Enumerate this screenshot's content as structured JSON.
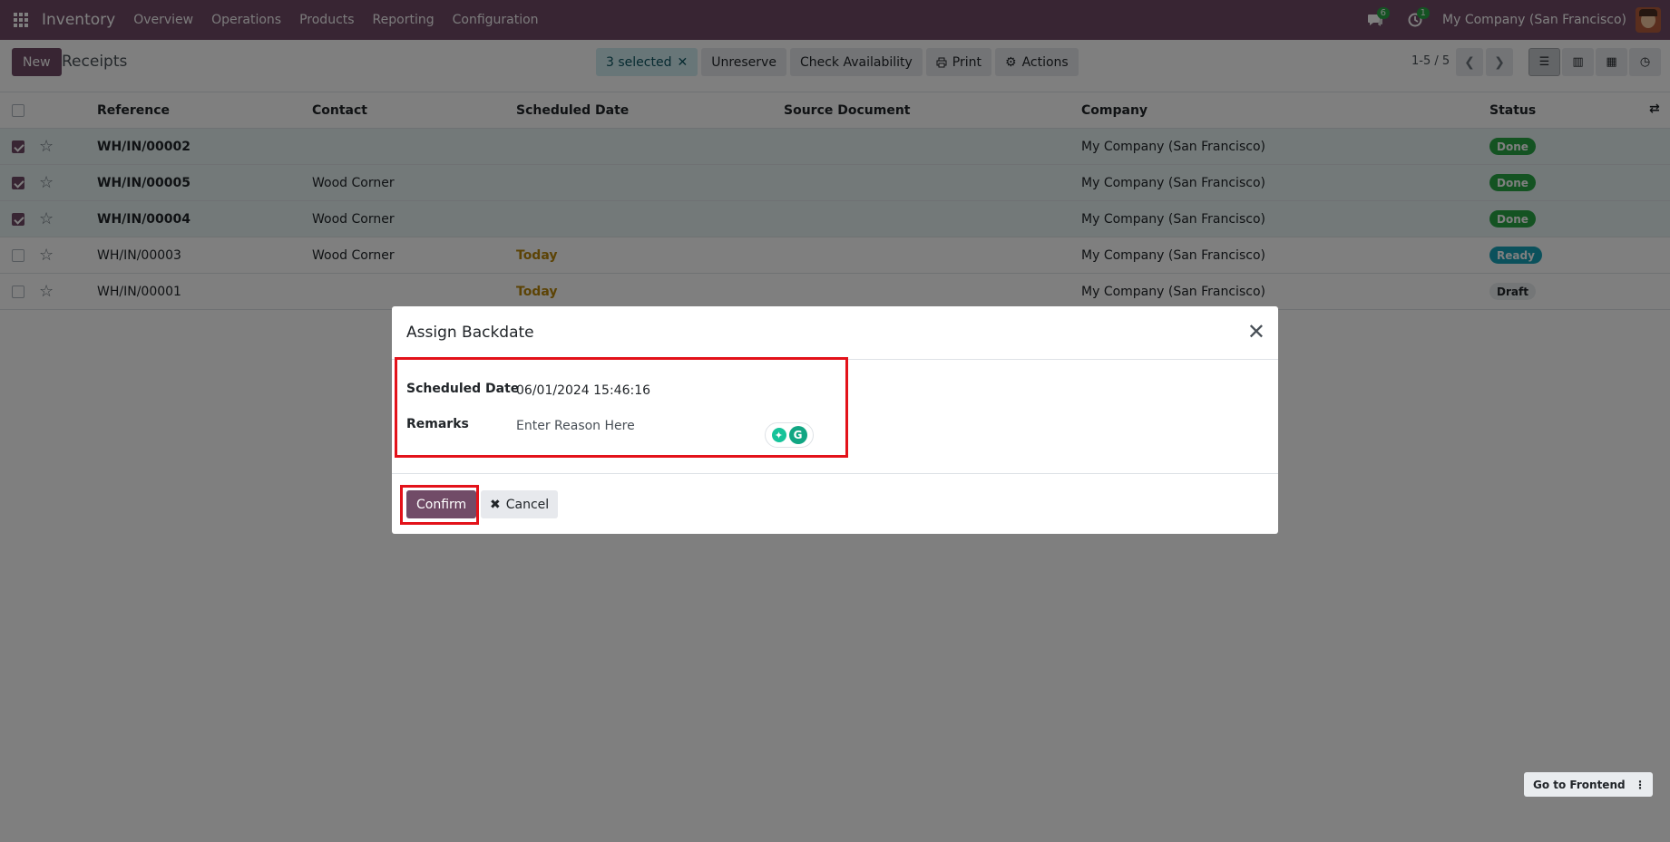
{
  "navbar": {
    "app_name": "Inventory",
    "menu": [
      "Overview",
      "Operations",
      "Products",
      "Reporting",
      "Configuration"
    ],
    "chat_badge": "6",
    "activity_badge": "1",
    "company": "My Company (San Francisco)"
  },
  "control_panel": {
    "new_label": "New",
    "title": "Receipts",
    "selected_label": "3 selected",
    "actions": [
      "Unreserve",
      "Check Availability",
      "Print",
      "Actions"
    ],
    "pager": "1-5 / 5"
  },
  "table": {
    "columns": [
      "Reference",
      "Contact",
      "Scheduled Date",
      "Source Document",
      "Company",
      "Status"
    ],
    "rows": [
      {
        "reference": "WH/IN/00002",
        "contact": "",
        "scheduled": "",
        "source": "",
        "company": "My Company (San Francisco)",
        "status": "Done",
        "checked": true
      },
      {
        "reference": "WH/IN/00005",
        "contact": "Wood Corner",
        "scheduled": "",
        "source": "",
        "company": "My Company (San Francisco)",
        "status": "Done",
        "checked": true
      },
      {
        "reference": "WH/IN/00004",
        "contact": "Wood Corner",
        "scheduled": "",
        "source": "",
        "company": "My Company (San Francisco)",
        "status": "Done",
        "checked": true
      },
      {
        "reference": "WH/IN/00003",
        "contact": "Wood Corner",
        "scheduled": "Today",
        "source": "",
        "company": "My Company (San Francisco)",
        "status": "Ready",
        "checked": false
      },
      {
        "reference": "WH/IN/00001",
        "contact": "",
        "scheduled": "Today",
        "source": "",
        "company": "My Company (San Francisco)",
        "status": "Draft",
        "checked": false
      }
    ]
  },
  "modal": {
    "title": "Assign Backdate",
    "scheduled_date_label": "Scheduled Date",
    "scheduled_date_value": "06/01/2024 15:46:16",
    "remarks_label": "Remarks",
    "remarks_placeholder": "Enter Reason Here",
    "confirm_label": "Confirm",
    "cancel_label": "Cancel"
  },
  "floater": {
    "label": "Go to Frontend"
  },
  "colors": {
    "brand": "#714b67",
    "highlight": "#e3121a",
    "done": "#28a745",
    "ready": "#17a2b8"
  }
}
